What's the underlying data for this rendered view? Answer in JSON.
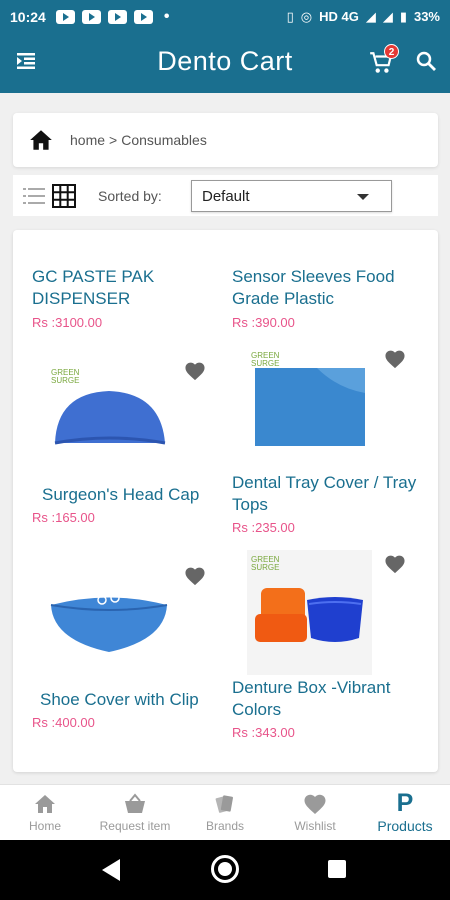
{
  "status_bar": {
    "time": "10:24",
    "network": "HD 4G",
    "battery": "33%"
  },
  "app_bar": {
    "title": "Dento Cart",
    "cart_count": "2"
  },
  "breadcrumb": {
    "home": "home",
    "separator": ">",
    "current": "Consumables"
  },
  "sort": {
    "label": "Sorted by:",
    "selected": "Default"
  },
  "products": [
    {
      "name": "GC PASTE PAK DISPENSER",
      "price": "Rs :3100.00",
      "image": "none"
    },
    {
      "name": "Sensor Sleeves Food Grade Plastic",
      "price": "Rs :390.00",
      "image": "none"
    },
    {
      "name": "Surgeon's Head Cap",
      "price": "Rs :165.00",
      "image": "blue-head-cap"
    },
    {
      "name": "Dental Tray Cover / Tray Tops",
      "price": "Rs :235.00",
      "image": "blue-tray-cover"
    },
    {
      "name": "Shoe Cover with Clip",
      "price": "Rs :400.00",
      "image": "blue-shoe-cover"
    },
    {
      "name": "Denture Box -Vibrant Colors",
      "price": "Rs :343.00",
      "image": "denture-boxes"
    }
  ],
  "bottom_nav": [
    {
      "label": "Home",
      "icon": "home-icon"
    },
    {
      "label": "Request item",
      "icon": "basket-icon"
    },
    {
      "label": "Brands",
      "icon": "brands-icon"
    },
    {
      "label": "Wishlist",
      "icon": "heart-icon"
    },
    {
      "label": "Products",
      "icon": "P"
    }
  ],
  "colors": {
    "primary": "#1a6f8f",
    "price": "#e8548a",
    "badge": "#e53935",
    "product_blue": "#3f6fd1"
  }
}
